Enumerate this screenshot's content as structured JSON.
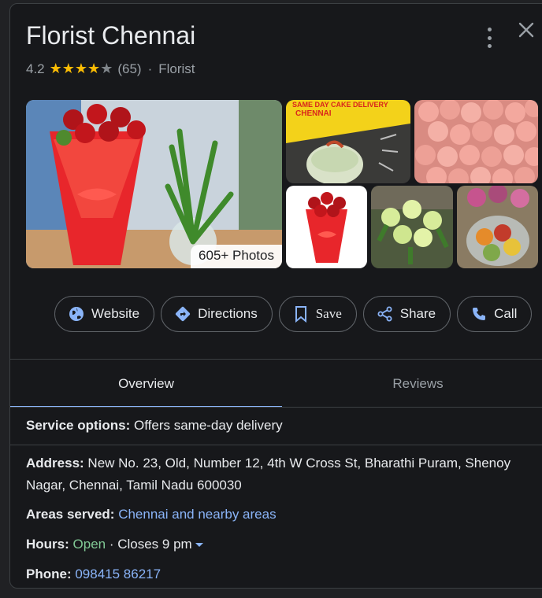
{
  "place": {
    "name": "Florist Chennai",
    "rating": "4.2",
    "review_count": "(65)",
    "category": "Florist"
  },
  "photos": {
    "count_label": "605+ Photos",
    "banner_text_1": "SAME DAY CAKE DELIVERY",
    "banner_text_2": "CHENNAI"
  },
  "actions": {
    "website": "Website",
    "directions": "Directions",
    "save": "Save",
    "share": "Share",
    "call": "Call"
  },
  "tabs": {
    "overview": "Overview",
    "reviews": "Reviews"
  },
  "details": {
    "service_label": "Service options:",
    "service_value": "Offers same-day delivery",
    "address_label": "Address:",
    "address_value": "New No. 23, Old, Number 12, 4th W Cross St, Bharathi Puram, Shenoy Nagar, Chennai, Tamil Nadu 600030",
    "areas_label": "Areas served:",
    "areas_value": "Chennai and nearby areas",
    "hours_label": "Hours:",
    "hours_status": "Open",
    "hours_sep": " · ",
    "hours_close": "Closes 9 pm",
    "phone_label": "Phone:",
    "phone_value": "098415 86217"
  },
  "colors": {
    "background": "#17181b",
    "link": "#8ab4f8",
    "open": "#81c995",
    "star": "#fbbc04"
  }
}
